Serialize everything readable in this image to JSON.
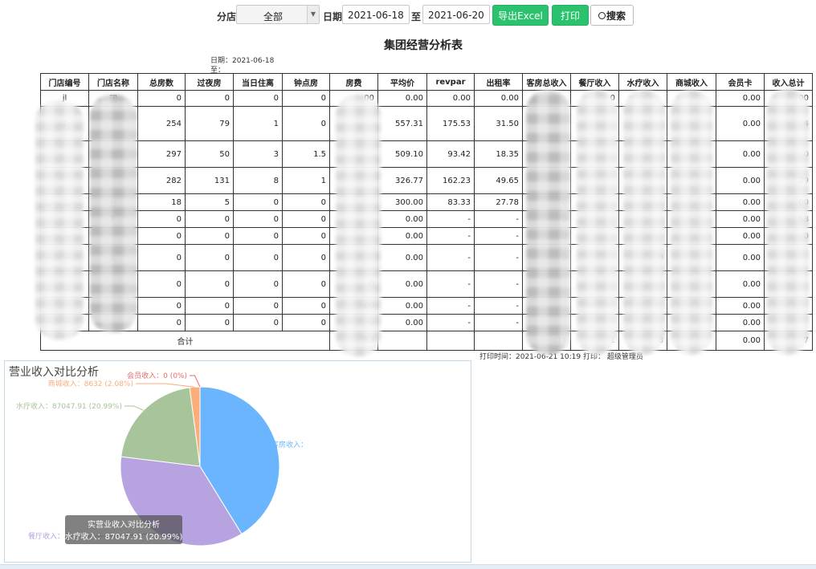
{
  "toolbar": {
    "branch_label": "分店",
    "branch_value": "全部",
    "date_label": "日期",
    "date_from": "2021-06-18",
    "to_label": "至",
    "date_to": "2021-06-20",
    "export_label": "导出Excel",
    "print_label": "打印",
    "search_label": "搜索"
  },
  "report": {
    "title": "集团经营分析表",
    "date_line": "日期：2021-06-18",
    "to_line": "至：",
    "columns": [
      "门店编号",
      "门店名称",
      "总房数",
      "过夜房",
      "当日住离",
      "钟点房",
      "房费",
      "平均价",
      "revpar",
      "出租率",
      "客房总收入",
      "餐厅收入",
      "水疗收入",
      "商城收入",
      "会员卡",
      "收入总计"
    ],
    "rows": [
      [
        "jl",
        "团",
        "0",
        "0",
        "0",
        "0",
        "00",
        "0.00",
        "0.00",
        "0.00",
        "",
        "0",
        "",
        "",
        "0.00",
        "00"
      ],
      [
        "1",
        "",
        "254",
        "79",
        "1",
        "0",
        "",
        "557.31",
        "175.53",
        "31.50",
        "",
        "",
        "",
        "",
        "0.00",
        "4"
      ],
      [
        "",
        "奥",
        "297",
        "50",
        "3",
        "1.5",
        "",
        "509.10",
        "93.42",
        "18.35",
        "",
        "",
        "",
        "",
        "0.00",
        "0"
      ],
      [
        "",
        "",
        "282",
        "131",
        "8",
        "1",
        "",
        "326.77",
        "162.23",
        "49.65",
        "",
        "",
        "",
        "",
        "0.00",
        "29"
      ],
      [
        "",
        "台",
        "18",
        "5",
        "0",
        "0",
        "",
        "300.00",
        "83.33",
        "27.78",
        "0",
        "",
        "",
        "",
        "0.00",
        "00"
      ],
      [
        "",
        "F",
        "0",
        "0",
        "0",
        "0",
        "",
        "0.00",
        "-",
        "-",
        "0",
        "",
        "",
        "",
        "0.00",
        "58"
      ],
      [
        "",
        "",
        "0",
        "0",
        "0",
        "0",
        "",
        "0.00",
        "-",
        "-",
        "0",
        "",
        "",
        "",
        "0.00",
        "0"
      ],
      [
        "",
        "夫",
        "0",
        "0",
        "0",
        "0",
        "",
        "0.00",
        "-",
        "-",
        "0",
        "",
        "0",
        "",
        "0.00",
        ""
      ],
      [
        "",
        "",
        "0",
        "0",
        "0",
        "0",
        "0",
        "0.00",
        "-",
        "-",
        "",
        "",
        "",
        "",
        "0.00",
        ""
      ],
      [
        "",
        "",
        "0",
        "0",
        "0",
        "0",
        "00",
        "0.00",
        "-",
        "-",
        "",
        "",
        "",
        "",
        "0.00",
        ""
      ],
      [
        "",
        "",
        "0",
        "0",
        "0",
        "0",
        "0",
        "0.00",
        "-",
        "-",
        "",
        "",
        "",
        "",
        "0.00",
        ""
      ]
    ],
    "total_label": "合计",
    "total_row": [
      "",
      "",
      "",
      "",
      "",
      "",
      "53",
      "",
      "",
      "",
      "17",
      "1",
      "8",
      "",
      "0.00",
      "7"
    ],
    "print_time": "打印时间：2021-06-21 10:19  打印：  超级管理员"
  },
  "panel": {
    "title": "营业收入对比分析",
    "tooltip_title": "实营业收入对比分析",
    "tooltip_value": "水疗收入：87047.91 (20.99%)"
  },
  "chart_data": {
    "type": "pie",
    "title": "营业收入对比分析",
    "slices": [
      {
        "label": "客房收入：",
        "percent": 41.22,
        "color": "#6bb5ff"
      },
      {
        "label": "餐厅收入：",
        "percent": 35.71,
        "color": "#b7a3e0"
      },
      {
        "label": "水疗收入：87047.91 (20.99%)",
        "value": 87047.91,
        "percent": 20.99,
        "color": "#a7c49a"
      },
      {
        "label": "商城收入：8632 (2.08%)",
        "value": 8632,
        "percent": 2.08,
        "color": "#fbad7a"
      },
      {
        "label": "会员收入：0 (0%)",
        "value": 0,
        "percent": 0,
        "color": "#e86f6f"
      }
    ]
  },
  "colors": {
    "accent_green": "#2bc26e",
    "panel_border": "#c5d8e6"
  }
}
